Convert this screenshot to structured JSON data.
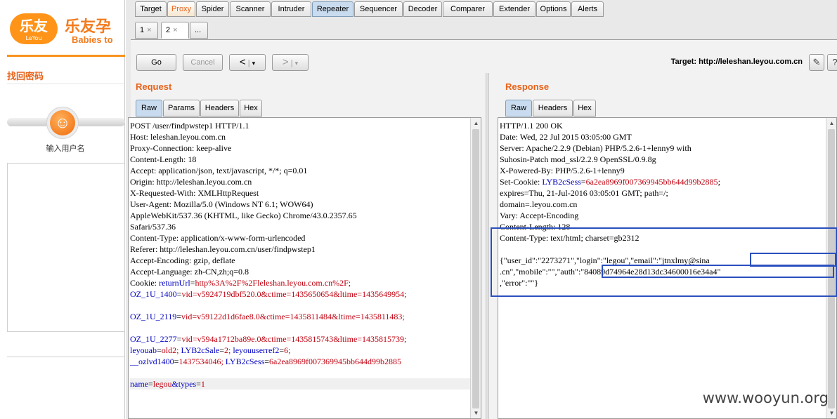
{
  "site": {
    "logo_text": "乐友",
    "logo_sub": "LeYou",
    "brand_cn": "乐友孕",
    "brand_en": "Babies to",
    "page_title": "找回密码",
    "step_label": "输入用户名"
  },
  "burp": {
    "tabs": [
      "Target",
      "Proxy",
      "Spider",
      "Scanner",
      "Intruder",
      "Repeater",
      "Sequencer",
      "Decoder",
      "Comparer",
      "Extender",
      "Options",
      "Alerts"
    ],
    "active_tab": "Repeater",
    "highlighted_tab": "Proxy",
    "repeater_tabs": [
      {
        "label": "1",
        "close": "×"
      },
      {
        "label": "2",
        "close": "×"
      },
      {
        "label": "..."
      }
    ],
    "go": "Go",
    "cancel": "Cancel",
    "back_glyph": "<",
    "forward_glyph": ">",
    "dropdown_glyph": "▾",
    "target_label": "Target: http://leleshan.leyou.com.cn",
    "request": {
      "title": "Request",
      "tabs": [
        "Raw",
        "Params",
        "Headers",
        "Hex"
      ],
      "lines": [
        "POST /user/findpwstep1 HTTP/1.1",
        "Host: leleshan.leyou.com.cn",
        "Proxy-Connection: keep-alive",
        "Content-Length: 18",
        "Accept: application/json, text/javascript, */*; q=0.01",
        "Origin: http://leleshan.leyou.com.cn",
        "X-Requested-With: XMLHttpRequest",
        "User-Agent: Mozilla/5.0 (Windows NT 6.1; WOW64)",
        "AppleWebKit/537.36 (KHTML, like Gecko) Chrome/43.0.2357.65",
        "Safari/537.36",
        "Content-Type: application/x-www-form-urlencoded",
        "Referer: http://leleshan.leyou.com.cn/user/findpwstep1",
        "Accept-Encoding: gzip, deflate",
        "Accept-Language: zh-CN,zh;q=0.8"
      ],
      "cookie_prefix": "Cookie: ",
      "cookie_lines": [
        [
          {
            "k": "returnUrl",
            "v": "http%3A%2F%2Fleleshan.leyou.com.cn%2F;"
          }
        ],
        [
          {
            "k": "OZ_1U_1400",
            "v": "vid=v5924719dbf520.0&ctime=1435650654&ltime=1435649954;"
          }
        ],
        [],
        [
          {
            "k": "OZ_1U_2119",
            "v": "vid=v59122d1d6fae8.0&ctime=1435811484&ltime=1435811483;"
          }
        ],
        [],
        [
          {
            "k": "OZ_1U_2277",
            "v": "vid=v594a1712ba89e.0&ctime=1435815743&ltime=1435815739;"
          }
        ],
        [
          {
            "k": "leyouab",
            "v": "old2;"
          },
          {
            "k": " LYB2cSale",
            "v": "2;"
          },
          {
            "k": " leyouuserref2",
            "v": "6;"
          }
        ],
        [
          {
            "k": "__ozlvd1400",
            "v": "1437534046;"
          },
          {
            "k": " LYB2cSess",
            "v": "6a2ea8969f007369945bb644d99b2885"
          }
        ],
        []
      ],
      "body": [
        {
          "k": "name",
          "v": "legou"
        },
        {
          "k": "&types",
          "v": "1"
        }
      ]
    },
    "response": {
      "title": "Response",
      "tabs": [
        "Raw",
        "Headers",
        "Hex"
      ],
      "lines_a": [
        "HTTP/1.1 200 OK",
        "Date: Wed, 22 Jul 2015 03:05:00 GMT",
        "Server: Apache/2.2.9 (Debian) PHP/5.2.6-1+lenny9 with",
        "Suhosin-Patch mod_ssl/2.2.9 OpenSSL/0.9.8g",
        "X-Powered-By: PHP/5.2.6-1+lenny9"
      ],
      "set_cookie_prefix": "Set-Cookie: ",
      "set_cookie_key": "LYB2cSess",
      "set_cookie_value": "6a2ea8969f007369945bb644d99b2885",
      "set_cookie_rest": ";",
      "lines_b": [
        "expires=Thu, 21-Jul-2016 03:05:01 GMT; path=/;",
        "domain=.leyou.com.cn",
        "Vary: Accept-Encoding",
        "Content-Length: 128",
        "Content-Type: text/html; charset=gb2312",
        "",
        "{\"user_id\":\"2273271\",\"login\":\"legou\",\"email\":\"jtnxlmy@sina",
        ".cn\",\"mobile\":\"\",\"auth\":\"84089d74964e28d13dc34600016e34a4\"",
        ",\"error\":\"\"}"
      ]
    }
  },
  "watermark": "www.wooyun.org"
}
